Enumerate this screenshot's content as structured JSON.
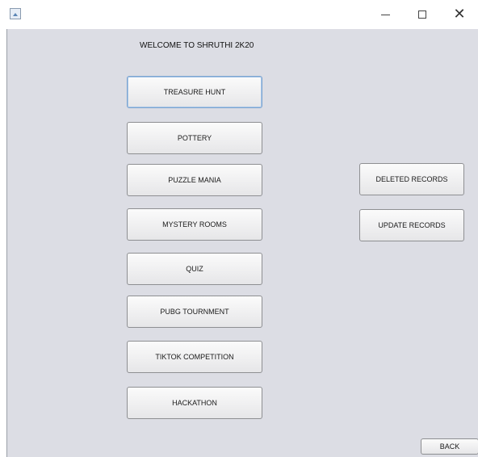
{
  "window": {
    "title_bar": {
      "app_icon": "java-app-icon",
      "controls": {
        "minimize_icon": "minimize-icon",
        "maximize_icon": "maximize-icon",
        "close_icon": "close-icon",
        "close_glyph": "✕"
      }
    }
  },
  "main": {
    "welcome_text": "WELCOME TO SHRUTHI 2K20",
    "events": [
      "TREASURE HUNT",
      "POTTERY",
      "PUZZLE MANIA",
      "MYSTERY ROOMS",
      "QUIZ",
      "PUBG TOURNMENT",
      "TIKTOK COMPETITION",
      "HACKATHON"
    ],
    "records": {
      "deleted_label": "DELETED RECORDS",
      "update_label": "UPDATE RECORDS"
    },
    "back_label": "BACK"
  }
}
